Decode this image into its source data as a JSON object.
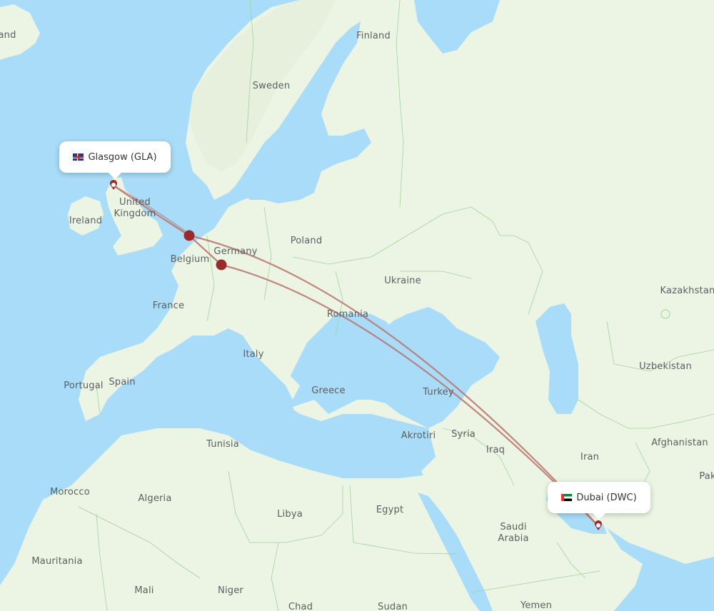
{
  "map": {
    "colors": {
      "water": "#a8dcf8",
      "land": "#ecf4e4",
      "land_dark": "#e2eed8",
      "border": "#9fd49a",
      "route": "#b8736e",
      "stop_marker": "#9b2a2a",
      "pin": "#9b2a2a"
    },
    "origin": {
      "city": "Glasgow",
      "code": "GLA",
      "label": "Glasgow (GLA)",
      "flag": "uk-flag"
    },
    "destination": {
      "city": "Dubai",
      "code": "DWC",
      "label": "Dubai (DWC)",
      "flag": "uae-flag"
    },
    "stopovers": [
      {
        "name": "stopover-amsterdam"
      },
      {
        "name": "stopover-frankfurt"
      }
    ],
    "country_labels": [
      "Iceland",
      "Finland",
      "Sweden",
      "United Kingdom",
      "Ireland",
      "Poland",
      "Germany",
      "Belgium",
      "Ukraine",
      "France",
      "Romania",
      "Kazakhstan",
      "Italy",
      "Uzbekistan",
      "Portugal",
      "Spain",
      "Greece",
      "Turkey",
      "Syria",
      "Akrotiri",
      "Tunisia",
      "Iraq",
      "Iran",
      "Afghanistan",
      "Pakistan",
      "Morocco",
      "Algeria",
      "Libya",
      "Egypt",
      "Saudi Arabia",
      "Mauritania",
      "Mali",
      "Niger",
      "Chad",
      "Sudan",
      "Yemen"
    ],
    "visible_label_text": {
      "Iceland": "and",
      "Pakistan": "Pak",
      "Kazakhstan": "Kazakhstan",
      "United Kingdom": "United\nKingdom",
      "Saudi Arabia": "Saudi\nArabia"
    }
  }
}
